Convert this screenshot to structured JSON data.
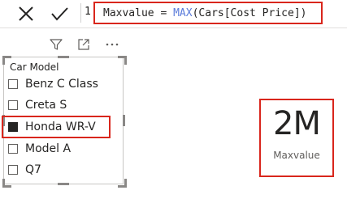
{
  "formula_bar": {
    "line_number": "1",
    "measure_name": "Maxvalue",
    "operator": " = ",
    "function": "MAX",
    "argument": "(Cars[Cost Price])",
    "cancel_icon": "close-icon",
    "commit_icon": "checkmark-icon"
  },
  "visual_header": {
    "icons": [
      "filter-icon",
      "focus-mode-icon",
      "more-options-icon"
    ]
  },
  "slicer": {
    "title": "Car Model",
    "items": [
      {
        "label": "Benz C Class",
        "checked": false
      },
      {
        "label": "Creta S",
        "checked": false
      },
      {
        "label": "Honda WR-V",
        "checked": true
      },
      {
        "label": "Model A",
        "checked": false
      },
      {
        "label": "Q7",
        "checked": false
      }
    ]
  },
  "card": {
    "value": "2M",
    "label": "Maxvalue"
  },
  "colors": {
    "highlight": "#d9261c",
    "function_keyword": "#5b7cdb",
    "text": "#252423"
  }
}
